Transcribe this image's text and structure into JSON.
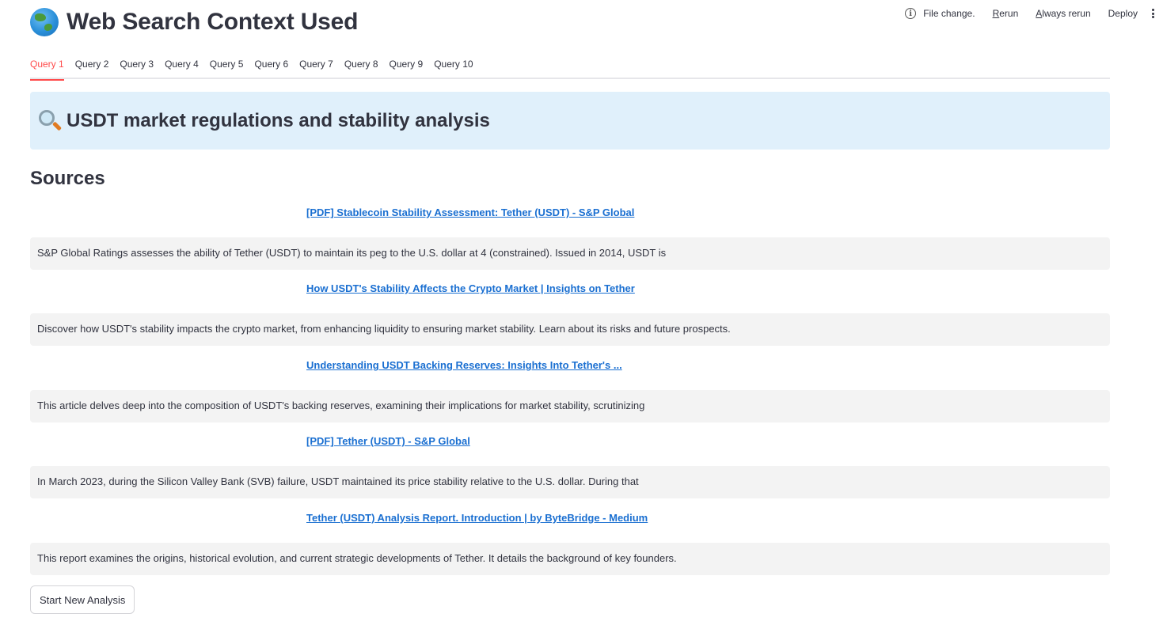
{
  "header": {
    "title": "Web Search Context Used",
    "title_icon": "globe-icon"
  },
  "toolbar": {
    "info_icon": "info-icon",
    "file_change": "File change.",
    "rerun_underlined": "R",
    "rerun_rest": "erun",
    "always_rerun_underlined": "A",
    "always_rerun_rest": "lways rerun",
    "deploy": "Deploy",
    "menu_icon": "kebab-menu-icon"
  },
  "tabs": [
    {
      "label": "Query 1",
      "active": true
    },
    {
      "label": "Query 2"
    },
    {
      "label": "Query 3"
    },
    {
      "label": "Query 4"
    },
    {
      "label": "Query 5"
    },
    {
      "label": "Query 6"
    },
    {
      "label": "Query 7"
    },
    {
      "label": "Query 8"
    },
    {
      "label": "Query 9"
    },
    {
      "label": "Query 10"
    }
  ],
  "query": {
    "icon": "magnifier-icon",
    "text": "USDT market regulations and stability analysis"
  },
  "sources": {
    "heading": "Sources",
    "items": [
      {
        "title": "[PDF] Stablecoin Stability Assessment: Tether (USDT) - S&P Global",
        "snippet": "S&P Global Ratings assesses the ability of Tether (USDT) to maintain its peg to the U.S. dollar at 4 (constrained). Issued in 2014, USDT is"
      },
      {
        "title": "How USDT's Stability Affects the Crypto Market | Insights on Tether",
        "snippet": "Discover how USDT's stability impacts the crypto market, from enhancing liquidity to ensuring market stability. Learn about its risks and future prospects."
      },
      {
        "title": "Understanding USDT Backing Reserves: Insights Into Tether's ...",
        "snippet": "This article delves deep into the composition of USDT's backing reserves, examining their implications for market stability, scrutinizing"
      },
      {
        "title": "[PDF] Tether (USDT) - S&P Global",
        "snippet": "In March 2023, during the Silicon Valley Bank (SVB) failure, USDT maintained its price stability relative to the U.S. dollar. During that"
      },
      {
        "title": "Tether (USDT) Analysis Report. Introduction | by ByteBridge - Medium",
        "snippet": "This report examines the origins, historical evolution, and current strategic developments of Tether. It details the background of key founders."
      }
    ]
  },
  "actions": {
    "start_new_analysis": "Start New Analysis"
  },
  "colors": {
    "accent": "#ff4b4b",
    "link": "#1a6fd1",
    "query_bg": "#e0f0fb",
    "snippet_bg": "#f3f3f3",
    "text": "#31333f"
  }
}
